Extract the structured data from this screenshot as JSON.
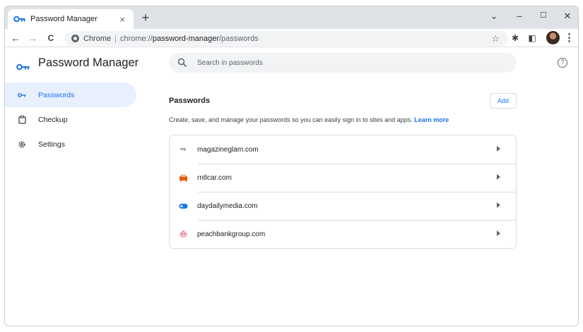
{
  "tab": {
    "title": "Password Manager",
    "close_glyph": "×",
    "new_tab_glyph": "+"
  },
  "window_controls": {
    "dropdown_glyph": "⌄",
    "minimize_glyph": "–",
    "maximize_glyph": "☐",
    "close_glyph": "✕"
  },
  "toolbar": {
    "back_glyph": "←",
    "forward_glyph": "→",
    "reload_glyph": "C",
    "chip_label": "Chrome",
    "separator": "|",
    "url_scheme": "chrome://",
    "url_host": "password-manager",
    "url_path": "/passwords",
    "bookmark_glyph": "☆",
    "extensions_glyph": "✱",
    "sidepanel_glyph": "◧",
    "menu_glyph": "⋮"
  },
  "app": {
    "title": "Password Manager",
    "search_placeholder": "Search in passwords",
    "help_glyph": "?"
  },
  "sidebar": {
    "items": [
      {
        "label": "Passwords",
        "icon": "key-icon",
        "active": true
      },
      {
        "label": "Checkup",
        "icon": "checkup-icon",
        "active": false
      },
      {
        "label": "Settings",
        "icon": "gear-icon",
        "active": false
      }
    ]
  },
  "main": {
    "section_title": "Passwords",
    "add_label": "Add",
    "description": "Create, save, and manage your passwords so you can easily sign in to sites and apps.",
    "learn_more": "Learn more",
    "sites": [
      {
        "name": "magazineglam.com",
        "favicon_text": "mg",
        "color": "#5f6368"
      },
      {
        "name": "rntlcar.com",
        "favicon_text": "",
        "color": "#e8590c"
      },
      {
        "name": "daydailymedia.com",
        "favicon_text": "",
        "color": "#1a73e8"
      },
      {
        "name": "peachbankgroup.com",
        "favicon_text": "",
        "color": "#f28b9b"
      }
    ]
  },
  "colors": {
    "accent": "#1a73e8",
    "active_nav_bg": "#e8f0fe",
    "tabstrip_bg": "#dfe3e7"
  }
}
